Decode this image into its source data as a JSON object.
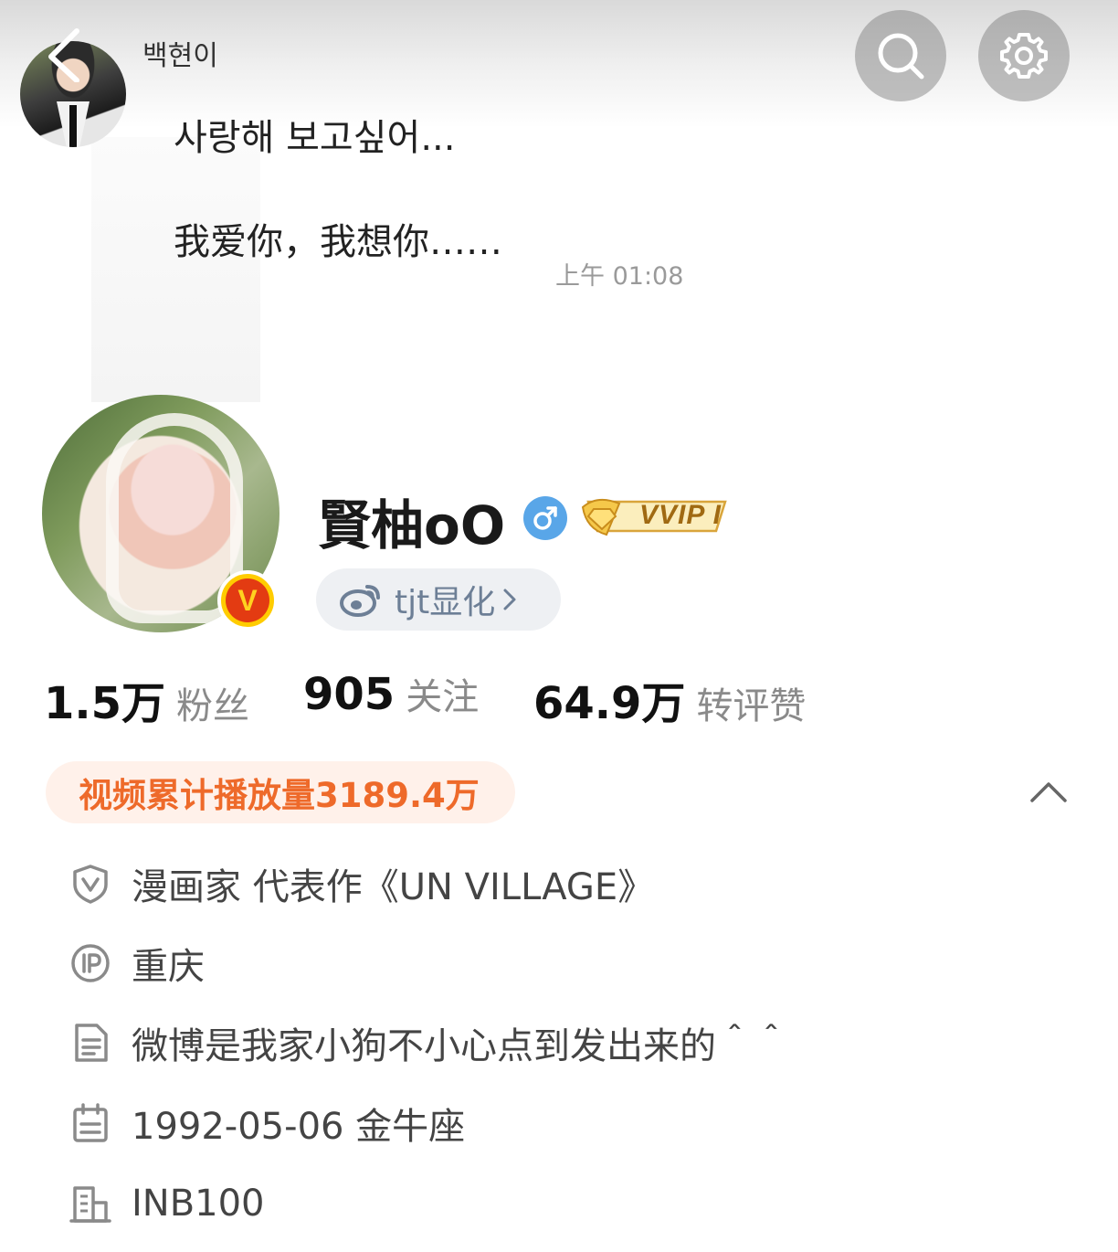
{
  "chat": {
    "sender": "백현이",
    "message_korean": "사랑해 보고싶어...",
    "message_chinese": "我爱你，我想你……",
    "time": "上午 01:08"
  },
  "profile": {
    "nickname": "賢柚oO",
    "vip_label": "VVIP I",
    "weibo_tag": "tjt显化",
    "verified_badge": "V"
  },
  "stats": [
    {
      "value": "1.5万",
      "label": "粉丝"
    },
    {
      "value": "905",
      "label": "关注"
    },
    {
      "value": "64.9万",
      "label": "转评赞"
    }
  ],
  "play_count": "视频累计播放量3189.4万",
  "info": [
    {
      "icon": "verified-shield-icon",
      "text": "漫画家 代表作《UN VILLAGE》"
    },
    {
      "icon": "ip-location-icon",
      "text": "重庆"
    },
    {
      "icon": "document-icon",
      "text": "微博是我家小狗不小心点到发出来的＾＾"
    },
    {
      "icon": "calendar-icon",
      "text": "1992-05-06 金牛座"
    },
    {
      "icon": "company-icon",
      "text": "INB100"
    }
  ],
  "colors": {
    "accent_orange": "#ee6a2a",
    "play_tag_bg": "#fff1ea",
    "gender_blue": "#59a6e8",
    "weibo_tag_text": "#6d7f96",
    "verified_yellow": "#ffcc00",
    "verified_red": "#e33b12"
  }
}
